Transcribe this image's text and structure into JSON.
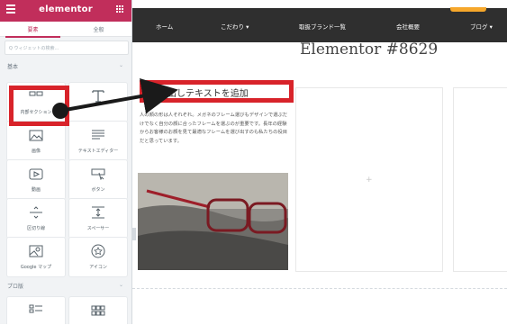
{
  "panel": {
    "brand": "elementor",
    "tabs": [
      "要素",
      "全般"
    ],
    "search_placeholder": "Q ウィジェットの検索...",
    "category_basic": "基本",
    "category_pro": "プロ版",
    "widgets": [
      {
        "label": "内部セクション",
        "icon": "inner-section-icon"
      },
      {
        "label": "",
        "icon": "heading-icon"
      },
      {
        "label": "画像",
        "icon": "image-icon"
      },
      {
        "label": "テキストエディター",
        "icon": "text-editor-icon"
      },
      {
        "label": "動画",
        "icon": "video-icon"
      },
      {
        "label": "ボタン",
        "icon": "button-icon"
      },
      {
        "label": "区切り線",
        "icon": "divider-icon"
      },
      {
        "label": "スペーサー",
        "icon": "spacer-icon"
      },
      {
        "label": "Google マップ",
        "icon": "map-icon"
      },
      {
        "label": "アイコン",
        "icon": "star-icon"
      },
      {
        "label": "",
        "icon": "posts-icon"
      },
      {
        "label": "",
        "icon": "portfolio-icon"
      }
    ]
  },
  "nav": {
    "items": [
      "ホーム",
      "こだわり ▾",
      "取扱ブランド一覧",
      "会社概要",
      "ブログ ▾"
    ]
  },
  "page": {
    "title": "Elementor #8629",
    "heading_widget": "見出しテキストを追加",
    "paragraph": "人の顔の形は人それぞれ。メガネのフレーム選びもデザインで選ぶだけでなく自分の顔に合ったフレームを選ぶのが重要です。長年の経験からお客様のお顔を見て最適なフレームを選び出すのも私たちの役目だと思っています。",
    "plus": "+"
  },
  "colors": {
    "brand": "#c12e5b",
    "highlight": "#d8232a",
    "nav_bg": "#2f2f2f",
    "nav_accent": "#f6a72b"
  }
}
